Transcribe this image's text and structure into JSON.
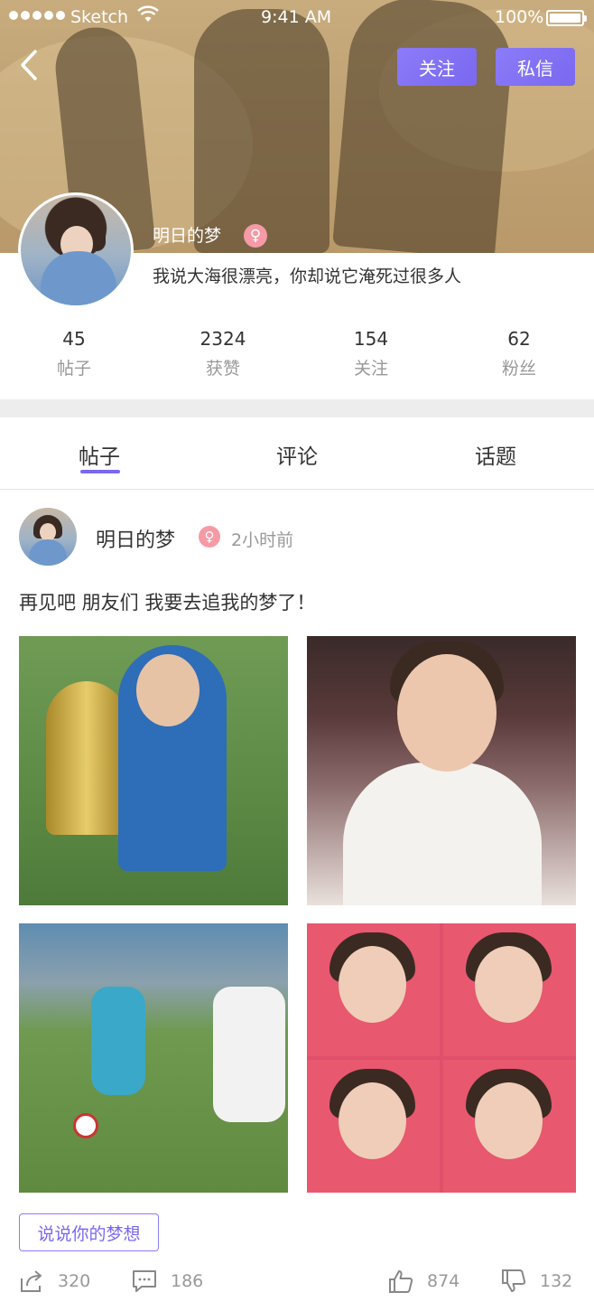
{
  "status_bar": {
    "carrier": "Sketch",
    "time": "9:41 AM",
    "battery": "100%"
  },
  "header": {
    "follow_label": "关注",
    "message_label": "私信"
  },
  "profile": {
    "name": "明日的梦",
    "gender_symbol": "♀",
    "bio": "我说大海很漂亮，你却说它淹死过很多人",
    "stats": [
      {
        "value": "45",
        "label": "帖子"
      },
      {
        "value": "2324",
        "label": "获赞"
      },
      {
        "value": "154",
        "label": "关注"
      },
      {
        "value": "62",
        "label": "粉丝"
      }
    ]
  },
  "tabs": [
    {
      "label": "帖子"
    },
    {
      "label": "评论"
    },
    {
      "label": "话题"
    }
  ],
  "post": {
    "author": "明日的梦",
    "gender_symbol": "♀",
    "time": "2小时前",
    "text": "再见吧 朋友们 我要去追我的梦了！",
    "tag": "说说你的梦想",
    "actions": {
      "share": "320",
      "comment": "186",
      "like": "874",
      "dislike": "132"
    }
  },
  "colors": {
    "accent": "#7a68f0",
    "gender_badge": "#f69aa6",
    "muted_text": "#999999"
  }
}
